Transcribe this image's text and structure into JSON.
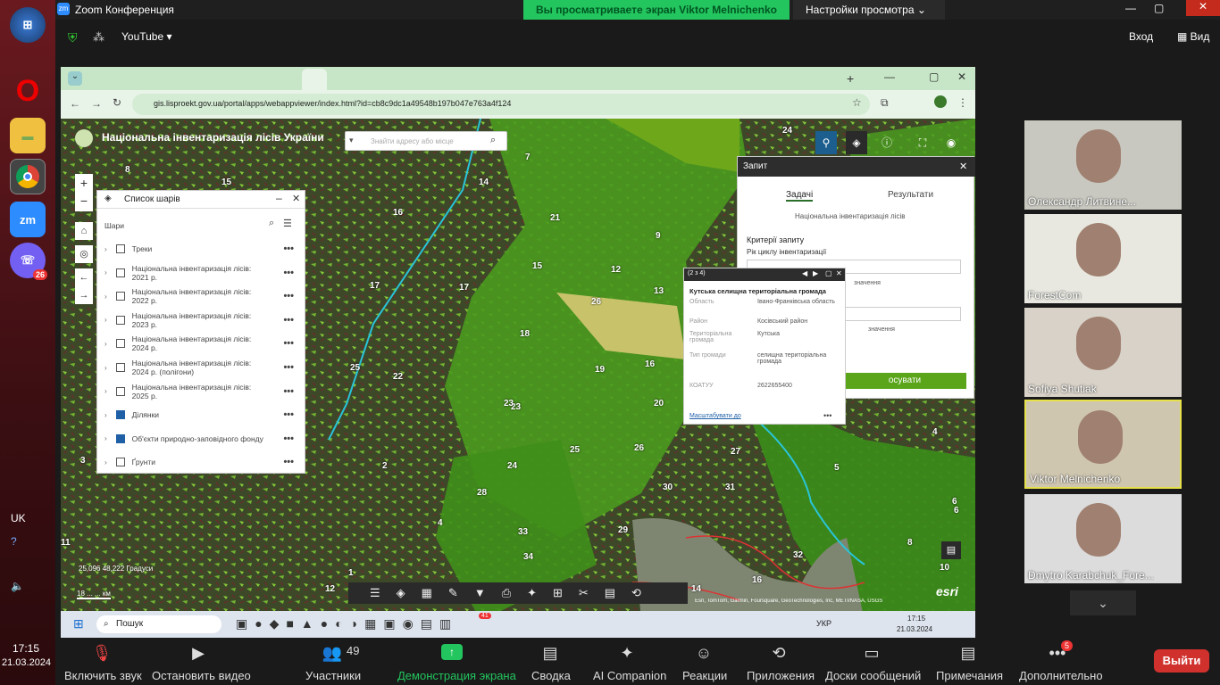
{
  "zoom": {
    "window_title": "Zoom Конференция",
    "share_banner": "Вы просматриваете экран Viktor Melnichenko",
    "view_settings": "Настройки просмотра",
    "youtube_label": "YouTube",
    "login": "Вход",
    "view": "Вид",
    "toolbar": {
      "unmute": "Включить звук",
      "stop_video": "Остановить видео",
      "participants": "Участники",
      "participants_count": "49",
      "share": "Демонстрация экрана",
      "summary": "Сводка",
      "ai": "AI Companion",
      "reactions": "Реакции",
      "apps": "Приложения",
      "boards": "Доски сообщений",
      "notes": "Примечания",
      "more": "Дополнительно",
      "more_badge": "5",
      "leave": "Выйти"
    },
    "participants": [
      {
        "name": "Олександр Литвине..."
      },
      {
        "name": "ForestCom"
      },
      {
        "name": "Sofiya Shutiak"
      },
      {
        "name": "Viktor Melnichenko"
      },
      {
        "name": "Dmytro Karabchuk_Fore..."
      }
    ]
  },
  "host_taskbar": {
    "lang": "UK",
    "time": "17:15",
    "date": "21.03.2024",
    "viber_badge": "26",
    "zoom_label": "zm"
  },
  "browser": {
    "url": "gis.lisproekt.gov.ua/portal/apps/webappviewer/index.html?id=cb8c9dc1a49548b197b047e763a4f124"
  },
  "gis": {
    "app_title": "Національна інвентаризація лісів України",
    "search_placeholder": "Знайти адресу або місце",
    "layers_title": "Список шарів",
    "layers_label": "Шари",
    "layers": [
      {
        "label": "Треки",
        "checked": false
      },
      {
        "label": "Національна інвентаризація лісів: 2021 р.",
        "checked": false
      },
      {
        "label": "Національна інвентаризація лісів: 2022 р.",
        "checked": false
      },
      {
        "label": "Національна інвентаризація лісів: 2023 р.",
        "checked": false
      },
      {
        "label": "Національна інвентаризація лісів: 2024 р.",
        "checked": false
      },
      {
        "label": "Національна інвентаризація лісів: 2024 р. (полігони)",
        "checked": false
      },
      {
        "label": "Національна інвентаризація лісів: 2025 р.",
        "checked": false
      },
      {
        "label": "Ділянки",
        "checked": true
      },
      {
        "label": "Об'єкти природно-заповідного фонду",
        "checked": true
      },
      {
        "label": "Ґрунти",
        "checked": false
      }
    ],
    "query": {
      "title": "Запит",
      "tab_tasks": "Задачі",
      "tab_results": "Результати",
      "subtitle": "Національна інвентаризація лісів",
      "criteria": "Критерії запиту",
      "cycle_year": "Рік циклу інвентаризації",
      "hint": "значення",
      "hint2": "значення",
      "apply": "осувати"
    },
    "popup": {
      "counter": "(2 з 4)",
      "title": "Кутська селищна територіальна громада",
      "rows": [
        {
          "k": "Область",
          "v": "Івано-Франківська область"
        },
        {
          "k": "Район",
          "v": "Косівський район"
        },
        {
          "k": "Територіальна громада",
          "v": "Кутська"
        },
        {
          "k": "Тип громади",
          "v": "селищна територіальна громада"
        },
        {
          "k": "КОАТУУ",
          "v": "2622655400"
        }
      ],
      "zoom_link": "Масштабувати до"
    },
    "coords": "25,096 48,222 Градуси",
    "scale": "18 ... ... км",
    "attribution": "Esri, TomTom, Garmin, Foursquare, GeoTechnologies, Inc, METI/NASA, USGS",
    "esri": "esri",
    "map_numbers": [
      "24",
      "8",
      "15",
      "14",
      "16",
      "7",
      "21",
      "9",
      "12",
      "15",
      "17",
      "17",
      "26",
      "13",
      "18",
      "19",
      "22",
      "25",
      "23",
      "20",
      "16",
      "27",
      "25",
      "26",
      "24",
      "23",
      "28",
      "30",
      "31",
      "29",
      "33",
      "34",
      "4",
      "5",
      "6",
      "3",
      "2",
      "1",
      "32",
      "16",
      "10",
      "11",
      "12",
      "14",
      "4",
      "6",
      "8"
    ]
  },
  "win_taskbar": {
    "search": "Пошук",
    "lang": "УКР",
    "time": "17:15",
    "date": "21.03.2024",
    "badge": "41"
  }
}
